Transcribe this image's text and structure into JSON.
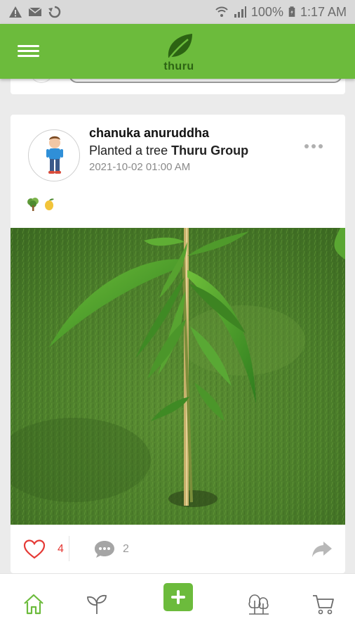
{
  "status_bar": {
    "battery": "100%",
    "time": "1:17 AM",
    "left_icons": [
      "warning-icon",
      "mail-icon",
      "sync-icon"
    ],
    "right_icons": [
      "wifi-icon",
      "signal-icon",
      "battery-icon"
    ]
  },
  "app_bar": {
    "logo_text": "thuru",
    "menu_icon": "hamburger-icon",
    "brand_color": "#6cbb3c"
  },
  "post": {
    "user_name": "chanuka anuruddha",
    "action_text": "Planted a tree ",
    "target": "Thuru Group",
    "timestamp": "2021-10-02 01:00 AM",
    "badges": [
      "tree-icon",
      "mango-icon"
    ],
    "likes": "4",
    "comments": "2",
    "photo": "mango-sapling-photo"
  },
  "bottom_nav": {
    "items": [
      "home-icon",
      "sprout-icon",
      "add-icon",
      "forest-icon",
      "cart-icon"
    ],
    "active": "home-icon"
  }
}
